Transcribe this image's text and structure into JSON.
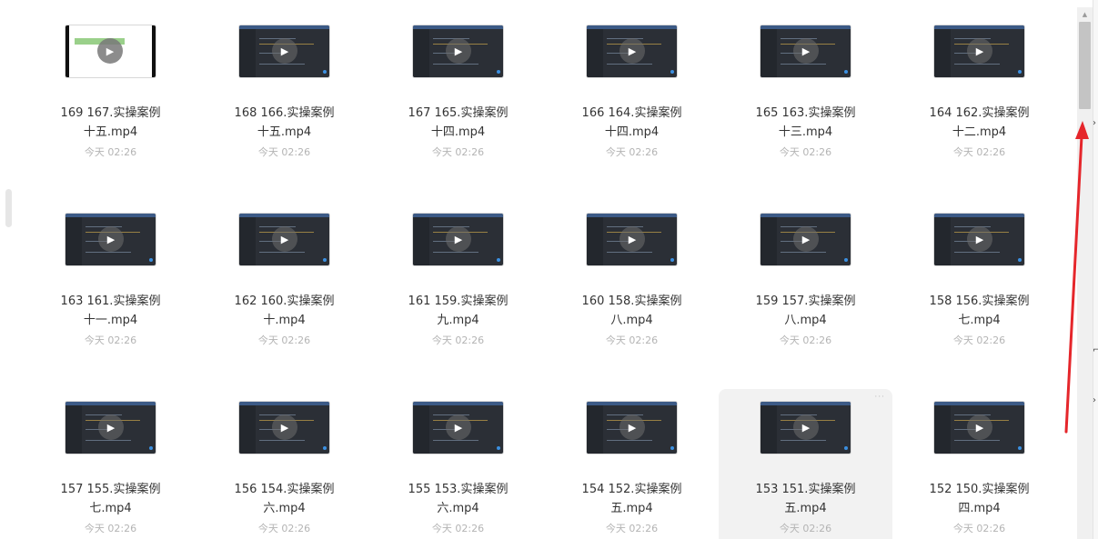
{
  "files": [
    {
      "title": "169 167.实操案例",
      "title2": "十五.mp4",
      "date": "今天 02:26"
    },
    {
      "title": "168 166.实操案例",
      "title2": "十五.mp4",
      "date": "今天 02:26"
    },
    {
      "title": "167 165.实操案例",
      "title2": "十四.mp4",
      "date": "今天 02:26"
    },
    {
      "title": "166 164.实操案例",
      "title2": "十四.mp4",
      "date": "今天 02:26"
    },
    {
      "title": "165 163.实操案例",
      "title2": "十三.mp4",
      "date": "今天 02:26"
    },
    {
      "title": "164 162.实操案例",
      "title2": "十二.mp4",
      "date": "今天 02:26"
    },
    {
      "title": "163 161.实操案例",
      "title2": "十一.mp4",
      "date": "今天 02:26"
    },
    {
      "title": "162 160.实操案例",
      "title2": "十.mp4",
      "date": "今天 02:26"
    },
    {
      "title": "161 159.实操案例",
      "title2": "九.mp4",
      "date": "今天 02:26"
    },
    {
      "title": "160 158.实操案例",
      "title2": "八.mp4",
      "date": "今天 02:26"
    },
    {
      "title": "159 157.实操案例",
      "title2": "八.mp4",
      "date": "今天 02:26"
    },
    {
      "title": "158 156.实操案例",
      "title2": "七.mp4",
      "date": "今天 02:26"
    },
    {
      "title": "157 155.实操案例",
      "title2": "七.mp4",
      "date": "今天 02:26"
    },
    {
      "title": "156 154.实操案例",
      "title2": "六.mp4",
      "date": "今天 02:26"
    },
    {
      "title": "155 153.实操案例",
      "title2": "六.mp4",
      "date": "今天 02:26"
    },
    {
      "title": "154 152.实操案例",
      "title2": "五.mp4",
      "date": "今天 02:26"
    },
    {
      "title": "153 151.实操案例",
      "title2": "五.mp4",
      "date": "今天 02:26"
    },
    {
      "title": "152 150.实操案例",
      "title2": "四.mp4",
      "date": "今天 02:26"
    }
  ],
  "hover_index": 16,
  "colors": {
    "annotation_arrow": "#e5262b",
    "accent": "#3b8fe0"
  },
  "icons": {
    "play": "play-icon",
    "more": "more-dots-icon",
    "scroll_up": "scroll-up-icon"
  }
}
